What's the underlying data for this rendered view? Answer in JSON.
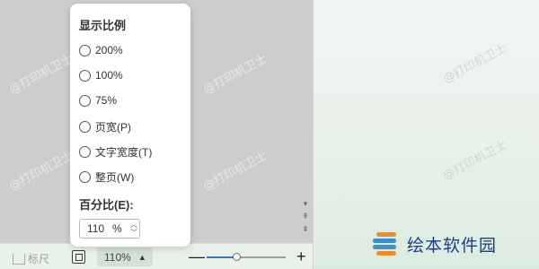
{
  "watermark": "@打印机卫士",
  "popup": {
    "title": "显示比例",
    "options": [
      "200%",
      "100%",
      "75%",
      "页宽(P)",
      "文字宽度(T)",
      "整页(W)"
    ],
    "custom_label": "百分比(E):",
    "custom_value": "110",
    "custom_unit": "%"
  },
  "statusbar": {
    "ruler_label": "标尺",
    "zoom_value": "110%",
    "zoom_slider_fraction": 0.38
  },
  "scroll": {
    "down": "▾",
    "prev_page": "⇞",
    "next_page": "⇟"
  },
  "logo": {
    "text": "绘本软件园",
    "colors": [
      "#f08a24",
      "#3b8fd8",
      "#3b8fd8",
      "#f08a24"
    ]
  }
}
